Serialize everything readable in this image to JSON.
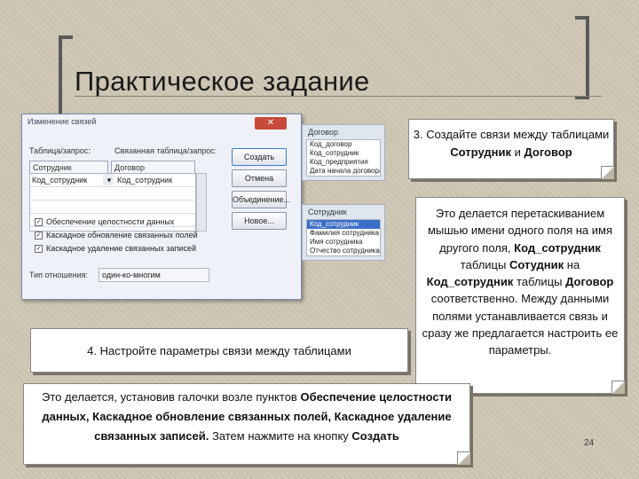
{
  "slide": {
    "title": "Практическое задание",
    "page_number": "24"
  },
  "dialog": {
    "caption": "Изменение связей",
    "close_label": "✕",
    "table_label": "Таблица/запрос:",
    "related_label": "Связанная таблица/запрос:",
    "table_value": "Сотрудник",
    "related_value": "Договор",
    "grid_left": "Код_сотрудник",
    "grid_right": "Код_сотрудник",
    "buttons": {
      "create": "Создать",
      "cancel": "Отмена",
      "join": "Объединение...",
      "new": "Новое..."
    },
    "checkboxes": [
      "Обеспечение целостности данных",
      "Каскадное обновление связанных полей",
      "Каскадное удаление связанных записей"
    ],
    "relation_type_label": "Тип отношения:",
    "relation_type_value": "один-ко-многим"
  },
  "panels": {
    "dogovor": {
      "title": "Договор",
      "fields": [
        "Код_договор",
        "Код_сотрудник",
        "Код_предприятия",
        "Дата начала договора"
      ]
    },
    "sotrudnik": {
      "title": "Сотрудник",
      "fields": [
        "Код_сотрудник",
        "Фамилия сотрудника",
        "Имя сотрудника",
        "Отчество сотрудника"
      ]
    }
  },
  "notes": {
    "step3": {
      "pre": "3. Создайте связи между таблицами ",
      "b1": "Сотрудник",
      "mid": " и ",
      "b2": "Договор"
    },
    "side": {
      "p1": "Это делается перетаскиванием мышью имени одного поля на имя другого поля, ",
      "b1": "Код_сотрудник",
      "p2": " таблицы ",
      "b2": "Сотудник",
      "p3": " на ",
      "b3": "Код_сотрудник",
      "p4": " таблицы ",
      "b4": "Договор",
      "p5": " соответственно. Между данными полями устанавливается связь и сразу же предлагается настроить ее параметры."
    },
    "step4": "4. Настройте параметры связи между таблицами",
    "bottom": {
      "p1": "Это делается, установив галочки возле пунктов ",
      "b1": "Обеспечение целостности данных, Каскадное обновление связанных полей, Каскадное удаление связанных записей.",
      "p2": " Затем нажмите на кнопку ",
      "b2": "Создать"
    }
  }
}
